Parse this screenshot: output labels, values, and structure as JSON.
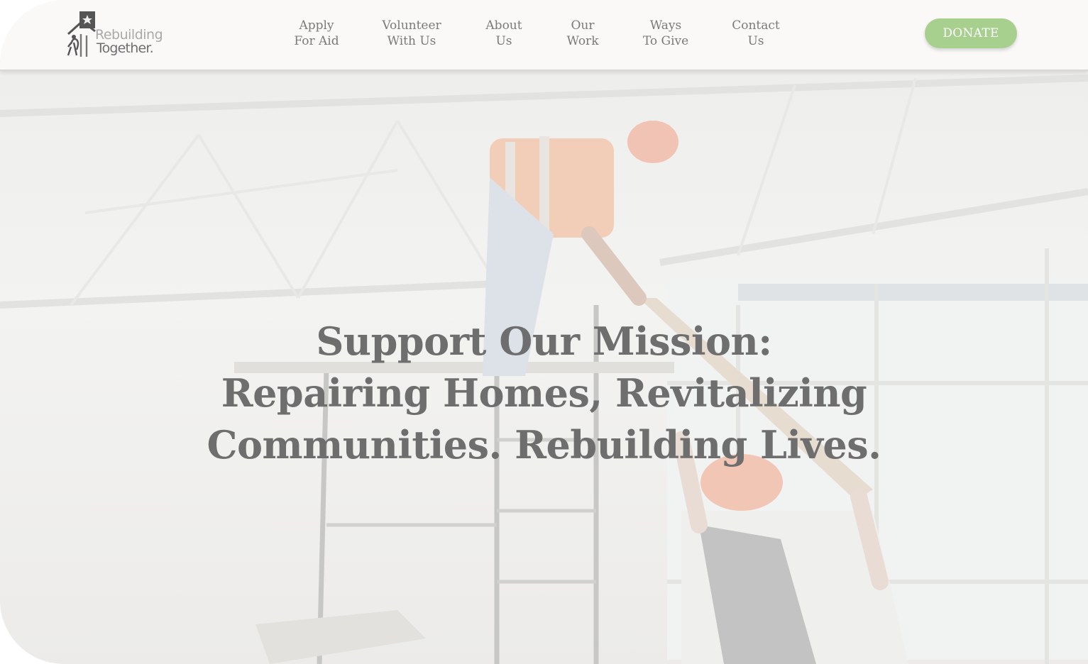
{
  "brand": {
    "line1": "Rebuilding",
    "line2": "Together."
  },
  "nav": [
    {
      "line1": "Apply",
      "line2": "For Aid"
    },
    {
      "line1": "Volunteer",
      "line2": "With Us"
    },
    {
      "line1": "About",
      "line2": "Us"
    },
    {
      "line1": "Our",
      "line2": "Work"
    },
    {
      "line1": "Ways",
      "line2": "To Give"
    },
    {
      "line1": "Contact",
      "line2": "Us"
    }
  ],
  "donate_label": "DONATE",
  "hero": {
    "line1": "Support Our Mission:",
    "line2": "Repairing Homes, Revitalizing",
    "line3": "Communities. Rebuilding Lives."
  },
  "colors": {
    "accent": "#a7cf8e",
    "header_bg": "#faf9f7",
    "text": "#6e6e6e",
    "nav_text": "#7a7a7a"
  }
}
